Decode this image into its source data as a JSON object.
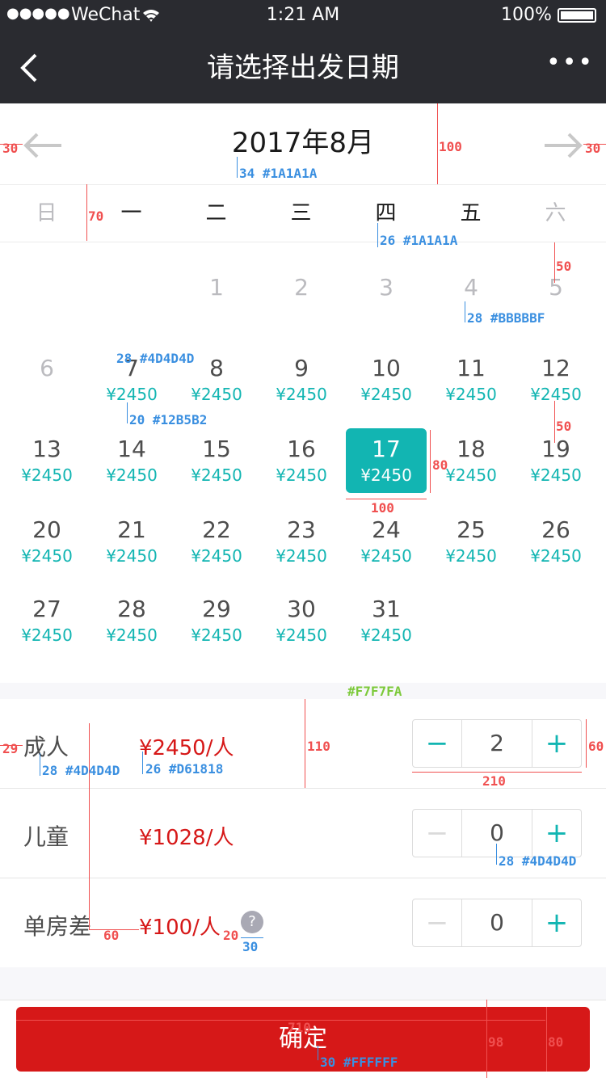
{
  "status": {
    "signal": "●●●●●",
    "carrier": "WeChat",
    "time": "1:21 AM",
    "battery": "100%"
  },
  "nav": {
    "title": "请选择出发日期",
    "more": "•••"
  },
  "calendar": {
    "month": "2017年8月",
    "weekdays": [
      "日",
      "一",
      "二",
      "三",
      "四",
      "五",
      "六"
    ],
    "price": "¥2450",
    "days": {
      "d1": "1",
      "d2": "2",
      "d3": "3",
      "d4": "4",
      "d5": "5",
      "d6": "6",
      "d7": "7",
      "d8": "8",
      "d9": "9",
      "d10": "10",
      "d11": "11",
      "d12": "12",
      "d13": "13",
      "d14": "14",
      "d15": "15",
      "d16": "16",
      "d17": "17",
      "d18": "18",
      "d19": "19",
      "d20": "20",
      "d21": "21",
      "d22": "22",
      "d23": "23",
      "d24": "24",
      "d25": "25",
      "d26": "26",
      "d27": "27",
      "d28": "28",
      "d29": "29",
      "d30": "30",
      "d31": "31"
    },
    "selected_day": "17"
  },
  "travelers": [
    {
      "label": "成人",
      "price": "¥2450/人",
      "count": "2",
      "minus": "−",
      "plus": "+"
    },
    {
      "label": "儿童",
      "price": "¥1028/人",
      "count": "0",
      "minus": "−",
      "plus": "+"
    },
    {
      "label": "单房差",
      "price": "¥100/人",
      "count": "0",
      "minus": "−",
      "plus": "+",
      "help": "?"
    }
  ],
  "confirm": {
    "label": "确定"
  },
  "annotations": {
    "a30l": "30",
    "a30r": "30",
    "a100": "100",
    "a34": "34 #1A1A1A",
    "a70": "70",
    "a26": "26 #1A1A1A",
    "a50a": "50",
    "a28bb": "28 #BBBBBF",
    "a28_4d": "28 #4D4D4D",
    "a20": "20 #12B5B2",
    "a50b": "50",
    "a80": "80",
    "a100b": "100",
    "af7": "#F7F7FA",
    "a29": "29",
    "a28_4d2": "28 #4D4D4D",
    "a26d6": "26 #D61818",
    "a110": "110",
    "a60": "60",
    "a210": "210",
    "a28_4d3": "28 #4D4D4D",
    "a60b": "60",
    "a20b": "20",
    "a30b": "30",
    "a710": "710",
    "a98": "98",
    "a80b": "80",
    "a30ff": "30 #FFFFFF"
  },
  "colors": {
    "accent": "#12B5B2",
    "red": "#D61818",
    "text": "#1A1A1A",
    "muted": "#BBBBBF",
    "bg_gap": "#F7F7FA"
  }
}
